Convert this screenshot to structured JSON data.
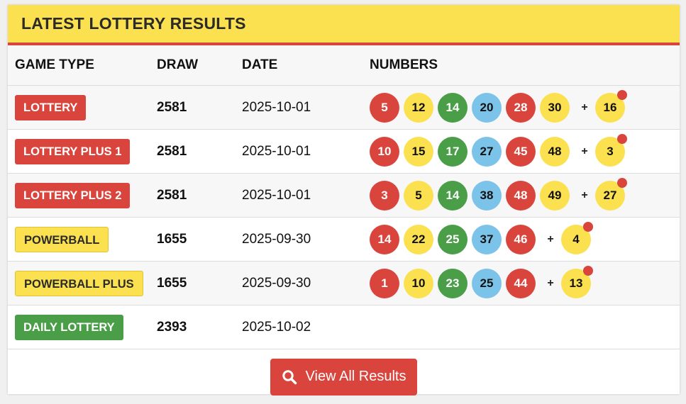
{
  "header": {
    "title": "LATEST LOTTERY RESULTS"
  },
  "columns": {
    "game_type": "GAME TYPE",
    "draw": "DRAW",
    "date": "DATE",
    "numbers": "NUMBERS"
  },
  "results": [
    {
      "game": "LOTTERY",
      "badge_color": "red",
      "draw": "2581",
      "date": "2025-10-01",
      "balls": [
        {
          "n": "5",
          "c": "red"
        },
        {
          "n": "12",
          "c": "yellow"
        },
        {
          "n": "14",
          "c": "green"
        },
        {
          "n": "20",
          "c": "blue"
        },
        {
          "n": "28",
          "c": "red"
        },
        {
          "n": "30",
          "c": "yellow"
        }
      ],
      "plus": "+",
      "bonus": "16"
    },
    {
      "game": "LOTTERY PLUS 1",
      "badge_color": "red",
      "draw": "2581",
      "date": "2025-10-01",
      "balls": [
        {
          "n": "10",
          "c": "red"
        },
        {
          "n": "15",
          "c": "yellow"
        },
        {
          "n": "17",
          "c": "green"
        },
        {
          "n": "27",
          "c": "blue"
        },
        {
          "n": "45",
          "c": "red"
        },
        {
          "n": "48",
          "c": "yellow"
        }
      ],
      "plus": "+",
      "bonus": "3"
    },
    {
      "game": "LOTTERY PLUS 2",
      "badge_color": "red",
      "draw": "2581",
      "date": "2025-10-01",
      "balls": [
        {
          "n": "3",
          "c": "red"
        },
        {
          "n": "5",
          "c": "yellow"
        },
        {
          "n": "14",
          "c": "green"
        },
        {
          "n": "38",
          "c": "blue"
        },
        {
          "n": "48",
          "c": "red"
        },
        {
          "n": "49",
          "c": "yellow"
        }
      ],
      "plus": "+",
      "bonus": "27"
    },
    {
      "game": "POWERBALL",
      "badge_color": "yellow",
      "draw": "1655",
      "date": "2025-09-30",
      "balls": [
        {
          "n": "14",
          "c": "red"
        },
        {
          "n": "22",
          "c": "yellow"
        },
        {
          "n": "25",
          "c": "green"
        },
        {
          "n": "37",
          "c": "blue"
        },
        {
          "n": "46",
          "c": "red"
        }
      ],
      "plus": "+",
      "bonus": "4"
    },
    {
      "game": "POWERBALL PLUS",
      "badge_color": "yellow",
      "draw": "1655",
      "date": "2025-09-30",
      "balls": [
        {
          "n": "1",
          "c": "red"
        },
        {
          "n": "10",
          "c": "yellow"
        },
        {
          "n": "23",
          "c": "green"
        },
        {
          "n": "25",
          "c": "blue"
        },
        {
          "n": "44",
          "c": "red"
        }
      ],
      "plus": "+",
      "bonus": "13"
    },
    {
      "game": "DAILY LOTTERY",
      "badge_color": "green",
      "draw": "2393",
      "date": "2025-10-02",
      "balls": [],
      "plus": "",
      "bonus": ""
    }
  ],
  "footer": {
    "button_label": "View All Results",
    "button_icon": "search-icon"
  },
  "colors": {
    "accent_yellow": "#fbe04f",
    "accent_red": "#d9453d",
    "green": "#4a9e48",
    "blue": "#7cc3ea"
  }
}
